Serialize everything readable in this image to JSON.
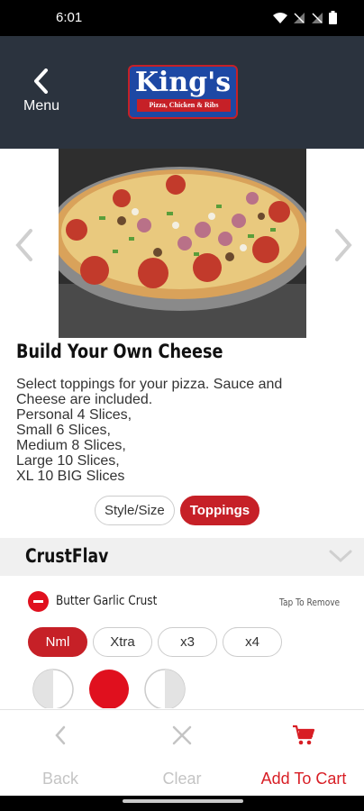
{
  "status_bar": {
    "time": "6:01"
  },
  "header": {
    "menu_label": "Menu",
    "logo_text": "King's",
    "logo_subtitle": "Pizza, Chicken & Ribs"
  },
  "product": {
    "title": "Build Your Own Cheese",
    "description_lines": [
      "Select toppings for your pizza. Sauce and",
      "Cheese are included.",
      "Personal 4 Slices,",
      "Small 6 Slices,",
      "Medium 8 Slices,",
      "Large 10 Slices,",
      "XL 10 BIG Slices"
    ]
  },
  "tabs": [
    {
      "label": "Style/Size",
      "active": false
    },
    {
      "label": "Toppings",
      "active": true
    }
  ],
  "section": {
    "title": "CrustFlav"
  },
  "topping": {
    "name": "Butter Garlic Crust",
    "action_label": "Tap To Remove",
    "quantity_options": [
      {
        "label": "Nml",
        "active": true
      },
      {
        "label": "Xtra",
        "active": false
      },
      {
        "label": "x3",
        "active": false
      },
      {
        "label": "x4",
        "active": false
      }
    ]
  },
  "bottom_bar": {
    "back_label": "Back",
    "clear_label": "Clear",
    "add_label": "Add To Cart"
  },
  "colors": {
    "header_bg": "#2b333e",
    "accent_red": "#c62027",
    "logo_blue": "#1d48a4"
  }
}
